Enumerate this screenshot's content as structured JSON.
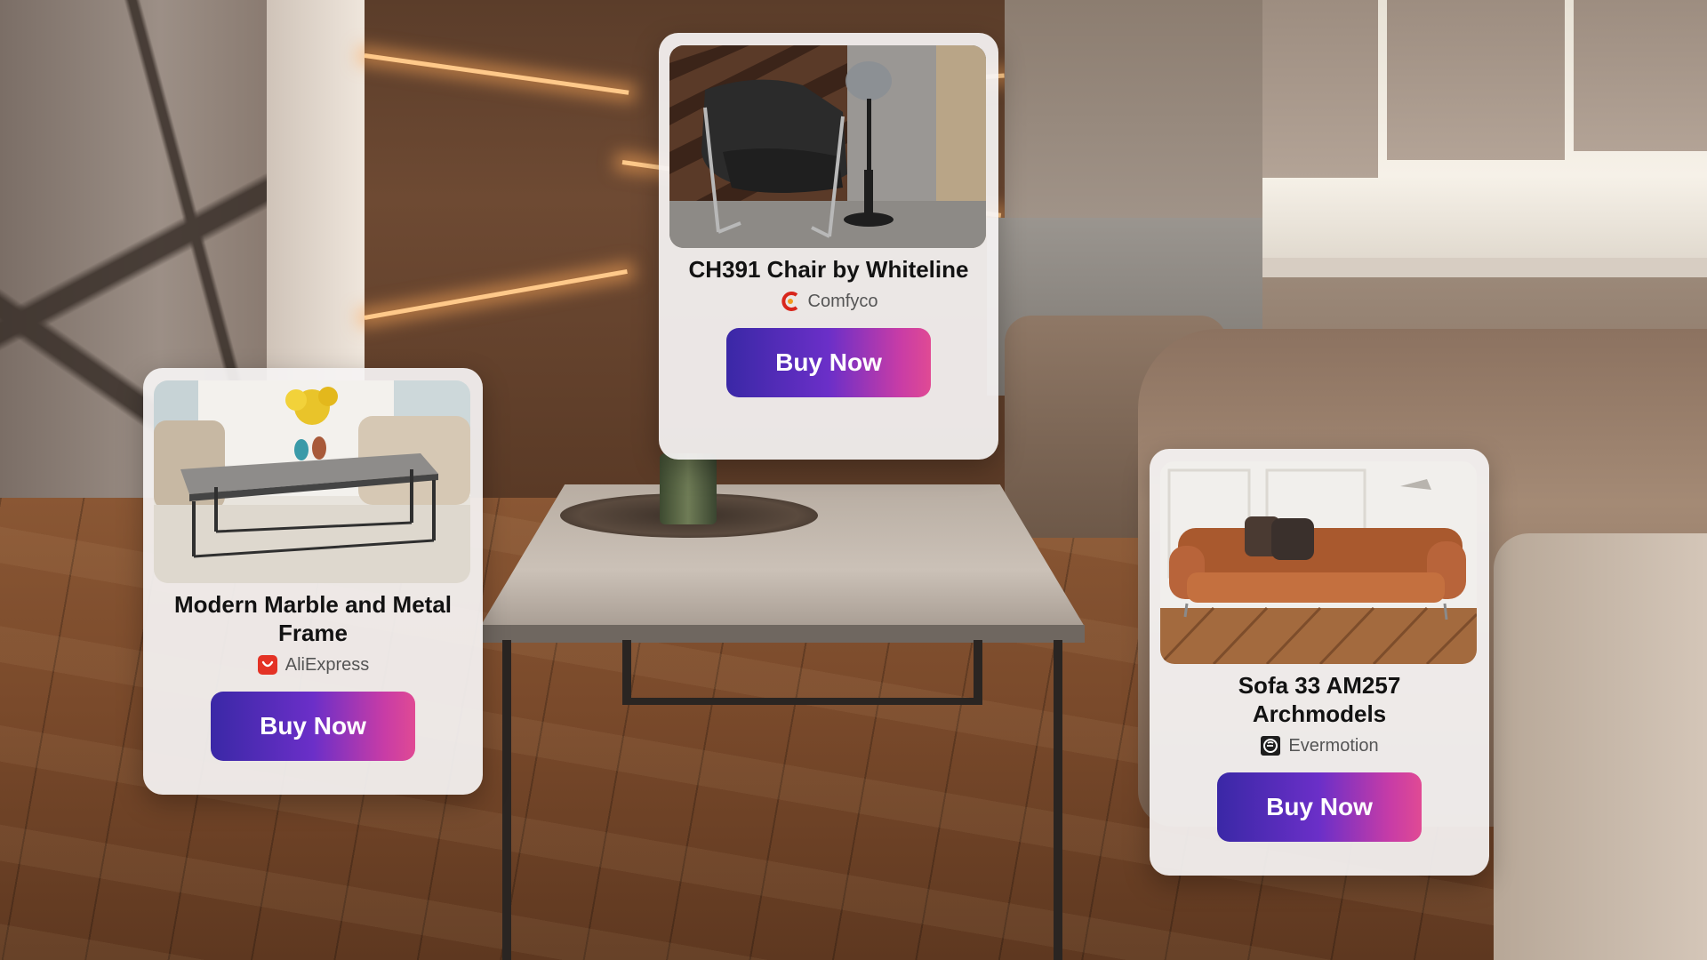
{
  "cards": [
    {
      "id": "chair",
      "title": "CH391 Chair by Whiteline",
      "store": "Comfyco",
      "store_icon": "comfyco-logo-icon",
      "button_label": "Buy Now"
    },
    {
      "id": "table",
      "title": "Modern Marble and Metal Frame",
      "store": "AliExpress",
      "store_icon": "aliexpress-logo-icon",
      "button_label": "Buy Now"
    },
    {
      "id": "sofa",
      "title": "Sofa 33 AM257 Archmodels",
      "store": "Evermotion",
      "store_icon": "evermotion-logo-icon",
      "button_label": "Buy Now"
    }
  ],
  "colors": {
    "button_gradient_start": "#3a28a6",
    "button_gradient_mid": "#6b2fc8",
    "button_gradient_end": "#e04a94",
    "card_background": "#f5f3f3",
    "aliexpress_red": "#e43225",
    "comfyco_red": "#d8261c"
  }
}
